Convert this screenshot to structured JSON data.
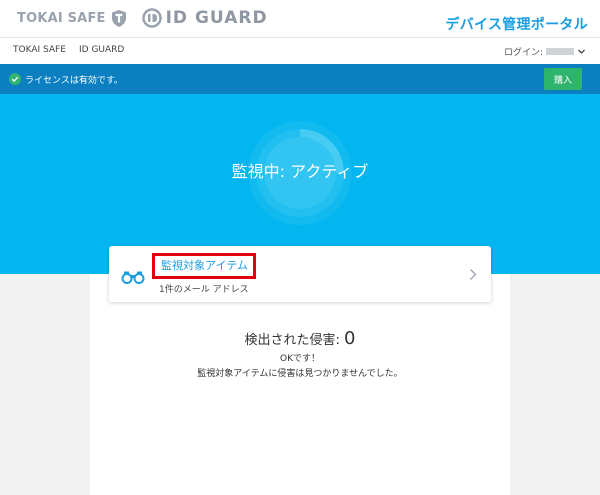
{
  "header": {
    "brand_primary": "TOKAI SAFE",
    "brand_secondary": "ID GUARD",
    "portal_title": "デバイス管理ポータル"
  },
  "nav": {
    "items": [
      {
        "label": "TOKAI SAFE"
      },
      {
        "label": "ID GUARD"
      }
    ],
    "login_label": "ログイン:"
  },
  "license": {
    "message": "ライセンスは有効です。",
    "buy_label": "購入"
  },
  "status": {
    "text": "監視中: アクティブ"
  },
  "monitored_card": {
    "title": "監視対象アイテム",
    "subtitle": "1件のメール アドレス"
  },
  "breaches": {
    "label": "検出された侵害: ",
    "count": "0",
    "ok": "OKです！",
    "none_found": "監視対象アイテムに侵害は見つかりませんでした。"
  },
  "colors": {
    "accent": "#03b6ef",
    "license_bar": "#0b7fbf",
    "buy_button": "#2fb46e",
    "link": "#1a9ee0",
    "highlight_box": "#e3000f"
  },
  "icons": {
    "shield": "shield-icon",
    "id_logo": "id-logo-icon",
    "check": "check-circle-icon",
    "binoculars": "binoculars-icon",
    "chevron_down": "chevron-down-icon",
    "chevron_right": "chevron-right-icon"
  }
}
